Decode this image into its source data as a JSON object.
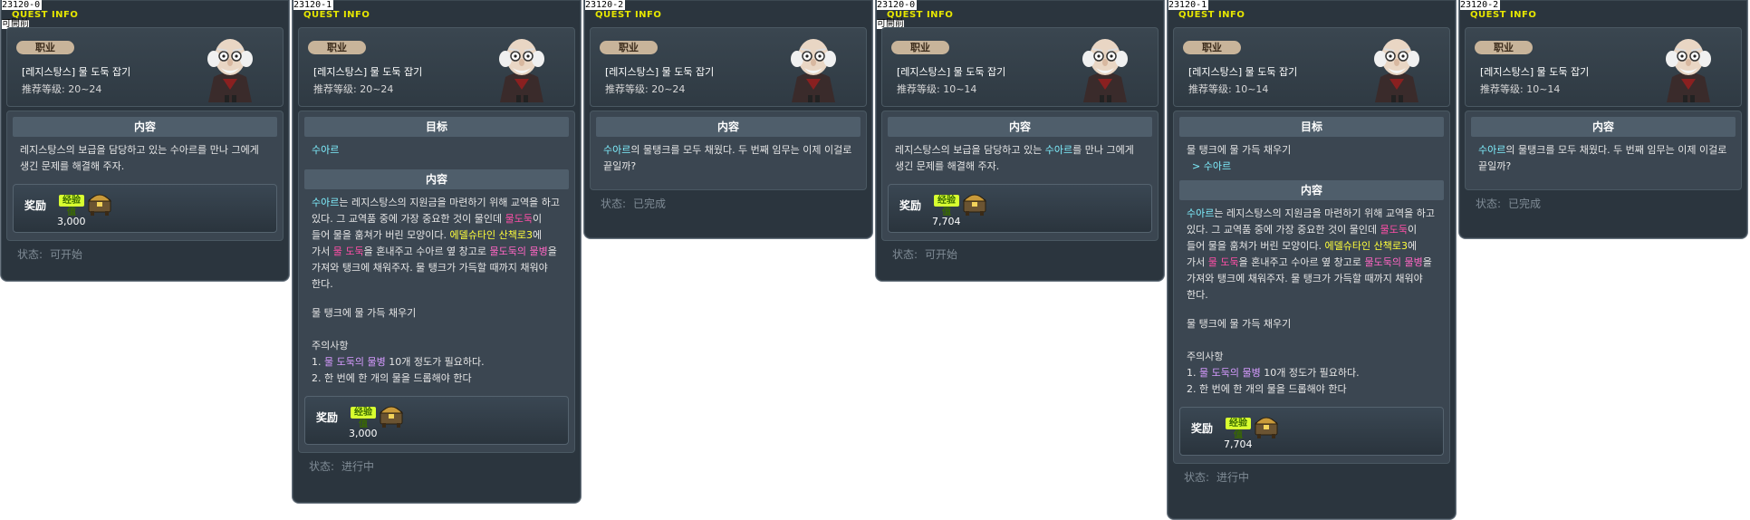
{
  "labels": {
    "quest_info": "QUEST INFO",
    "job": "职业",
    "content": "内容",
    "target": "目标",
    "reward": "奖励",
    "exp": "经验值",
    "status": "状态:"
  },
  "panels": [
    {
      "id": "23120-0",
      "title_status": "可開前",
      "quest_name": "[레지스탕스] 물 도둑 잡기",
      "level": "推荐等级: 20~24",
      "content": "레지스탕스의 보급을 담당하고 있는 수아르를 만나 그에게 생긴 문제를 해결해 주자.",
      "reward_exp": "3,000",
      "status": "可开始"
    },
    {
      "id": "23120-1",
      "quest_name": "[레지스탕스] 물 도둑 잡기",
      "level": "推荐等级: 20~24",
      "target": "수아르",
      "content_p1": "수아르는 레지스탕스의 지원금을 마련하기 위해 교역을 하고 있다. 그 교역품 중에 가장 중요한 것이 물인데 물도둑이 들어 물을 훔쳐가 버린 모양이다. 에델슈타인 산책로3에 가서 물 도둑을 혼내주고 수아르 옆 창고로 물도둑의 물병을 가져와 탱크에 채워주자. 물 탱크가 가득할 때까지 채워야 한다.",
      "content_p2": "물 탱크에 물 가득 채우기",
      "content_p3": "주의사항",
      "content_p4": "1. 물 도둑의 물병 10개 정도가 필요하다.",
      "content_p5": "2. 한 번에 한 개의 물을 드롭해야 한다",
      "reward_exp": "3,000",
      "status": "进行中"
    },
    {
      "id": "23120-2",
      "quest_name": "[레지스탕스] 물 도둑 잡기",
      "level": "推荐等级: 20~24",
      "content": "수아르의 물탱크를 모두 채웠다. 두 번째 임무는 이제 이걸로 끝일까?",
      "status": "已完成"
    },
    {
      "id": "23120-0",
      "title_status": "可開前",
      "quest_name": "[레지스탕스] 물 도둑 잡기",
      "level": "推荐等级: 10~14",
      "content": "레지스탕스의 보급을 담당하고 있는 수아르를 만나 그에게 생긴 문제를 해결해 주자.",
      "reward_exp": "7,704",
      "status": "可开始"
    },
    {
      "id": "23120-1",
      "quest_name": "[레지스탕스] 물 도둑 잡기",
      "level": "推荐等级: 10~14",
      "target": "물 탱크에 물 가득 채우기",
      "target_sub": "> 수아르",
      "content_p1": "수아르는 레지스탕스의 지원금을 마련하기 위해 교역을 하고 있다. 그 교역품 중에 가장 중요한 것이 물인데 물도둑이 들어 물을 훔쳐가 버린 모양이다. 에델슈타인 산책로3에 가서 물 도둑을 혼내주고 수아르 옆 창고로 물도둑의 물병을 가져와 탱크에 채워주자. 물 탱크가 가득할 때까지 채워야 한다.",
      "content_p2": "물 탱크에 물 가득 채우기",
      "content_p3": "주의사항",
      "content_p4": "1. 물 도둑의 물병 10개 정도가 필요하다.",
      "content_p5": "2. 한 번에 한 개의 물을 드롭해야 한다",
      "reward_exp": "7,704",
      "status": "进行中"
    },
    {
      "id": "23120-2",
      "quest_name": "[레지스탕스] 물 도둑 잡기",
      "level": "推荐等级: 10~14",
      "content": "수아르의 물탱크를 모두 채웠다. 두 번째 임무는 이제 이걸로 끝일까?",
      "status": "已完成"
    }
  ]
}
